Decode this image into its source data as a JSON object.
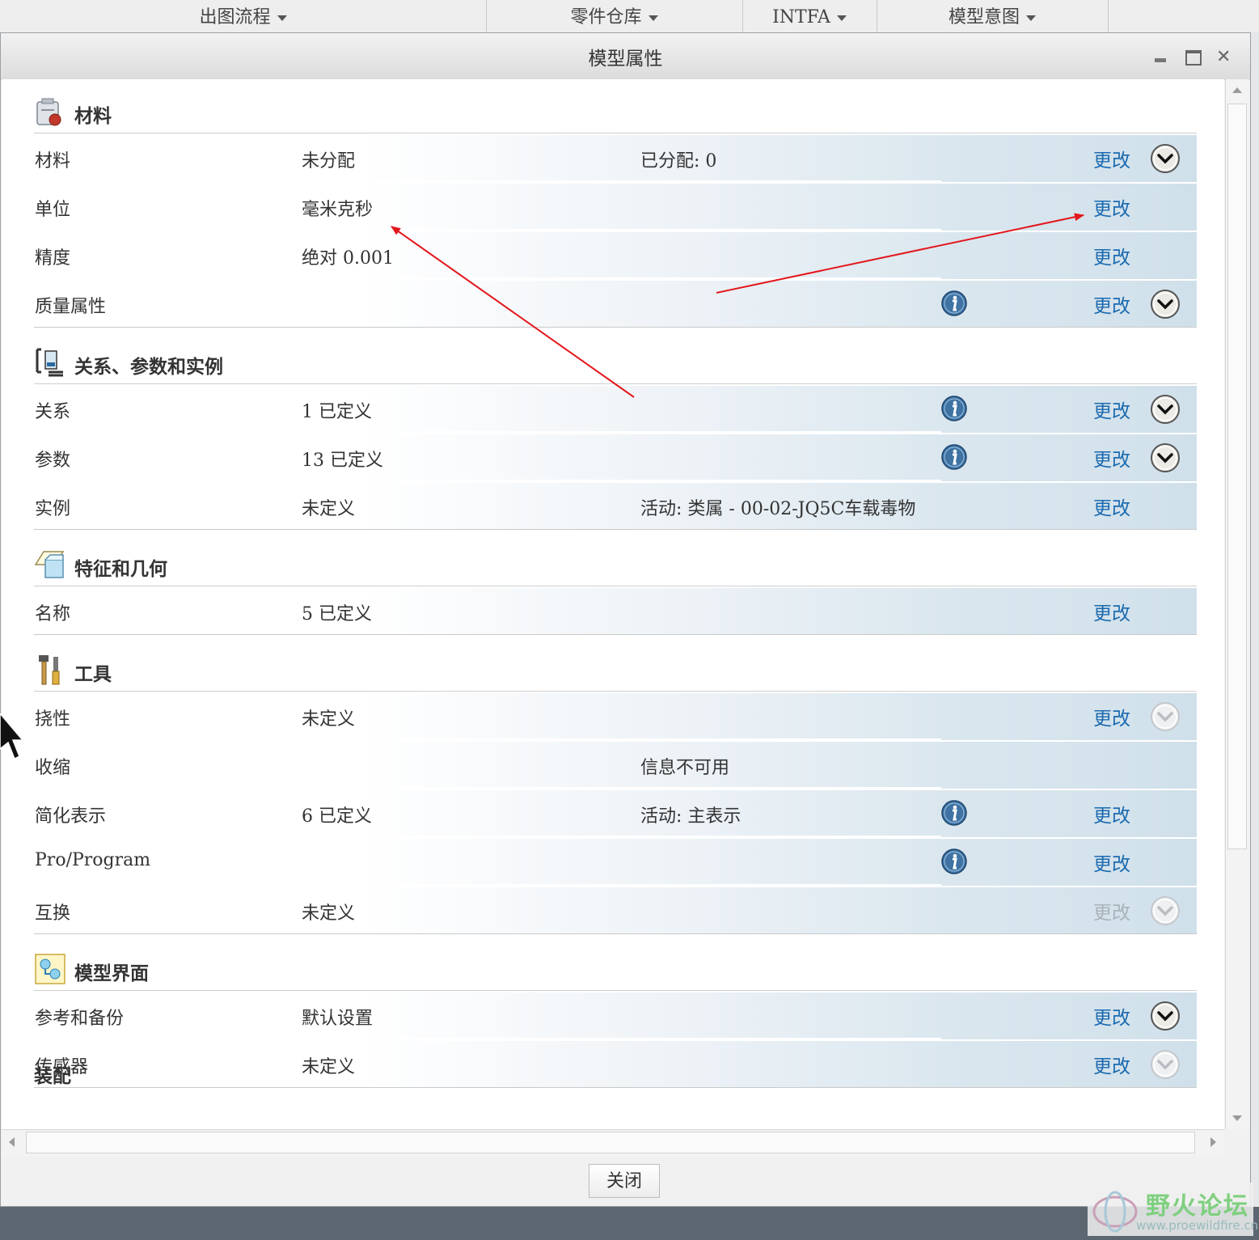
{
  "menubar": [
    {
      "label": "出图流程",
      "has_caret": true
    },
    {
      "label": "零件仓库",
      "has_caret": true
    },
    {
      "label": "INTFA",
      "has_caret": true
    },
    {
      "label": "模型意图",
      "has_caret": true
    }
  ],
  "dialog": {
    "title": "模型属性",
    "window_buttons": [
      "minimize-icon",
      "maximize-icon",
      "close-icon"
    ],
    "close_button": "关闭"
  },
  "sections": [
    {
      "title": "材料",
      "icon": "material-icon",
      "rows": [
        {
          "label": "材料",
          "value": "未分配",
          "extra": "已分配: 0",
          "info": false,
          "change": "更改",
          "change_enabled": true,
          "expand": "enabled"
        },
        {
          "label": "单位",
          "value": "毫米克秒",
          "extra": "",
          "info": false,
          "change": "更改",
          "change_enabled": true,
          "expand": "none"
        },
        {
          "label": "精度",
          "value": "绝对 0.001",
          "extra": "",
          "info": false,
          "change": "更改",
          "change_enabled": true,
          "expand": "none"
        },
        {
          "label": "质量属性",
          "value": "",
          "extra": "",
          "info": true,
          "change": "更改",
          "change_enabled": true,
          "expand": "enabled"
        }
      ]
    },
    {
      "title": "关系、参数和实例",
      "icon": "relations-icon",
      "rows": [
        {
          "label": "关系",
          "value": "1 已定义",
          "extra": "",
          "info": true,
          "change": "更改",
          "change_enabled": true,
          "expand": "enabled"
        },
        {
          "label": "参数",
          "value": "13 已定义",
          "extra": "",
          "info": true,
          "change": "更改",
          "change_enabled": true,
          "expand": "enabled"
        },
        {
          "label": "实例",
          "value": "未定义",
          "extra": "活动: 类属 - 00-02-JQ5C车载毒物",
          "info": false,
          "change": "更改",
          "change_enabled": true,
          "expand": "none"
        }
      ]
    },
    {
      "title": "特征和几何",
      "icon": "features-geometry-icon",
      "rows": [
        {
          "label": "名称",
          "value": "5 已定义",
          "extra": "",
          "info": false,
          "change": "更改",
          "change_enabled": true,
          "expand": "none"
        }
      ]
    },
    {
      "title": "工具",
      "icon": "tools-icon",
      "rows": [
        {
          "label": "挠性",
          "value": "未定义",
          "extra": "",
          "info": false,
          "change": "更改",
          "change_enabled": true,
          "expand": "disabled"
        },
        {
          "label": "收缩",
          "value": "",
          "extra": "信息不可用",
          "info": false,
          "change": "",
          "change_enabled": false,
          "expand": "none"
        },
        {
          "label": "简化表示",
          "value": "6 已定义",
          "extra": "活动: 主表示",
          "info": true,
          "change": "更改",
          "change_enabled": true,
          "expand": "none"
        },
        {
          "label": "Pro/Program",
          "value": "",
          "extra": "",
          "info": true,
          "change": "更改",
          "change_enabled": true,
          "expand": "none"
        },
        {
          "label": "互换",
          "value": "未定义",
          "extra": "",
          "info": false,
          "change": "更改",
          "change_enabled": false,
          "expand": "disabled"
        }
      ]
    },
    {
      "title": "模型界面",
      "icon": "model-interface-icon",
      "rows": [
        {
          "label": "参考和备份",
          "value": "默认设置",
          "extra": "",
          "info": false,
          "change": "更改",
          "change_enabled": true,
          "expand": "enabled"
        },
        {
          "label": "传感器",
          "value": "未定义",
          "extra": "",
          "info": false,
          "change": "更改",
          "change_enabled": true,
          "expand": "disabled"
        }
      ]
    }
  ],
  "partial_section": {
    "title": "装配"
  },
  "colors": {
    "link": "#1b6ab0",
    "annotation_arrow": "#e3161b"
  },
  "watermark": {
    "text": "野火论坛",
    "url": "www.proewildfire.cn"
  }
}
